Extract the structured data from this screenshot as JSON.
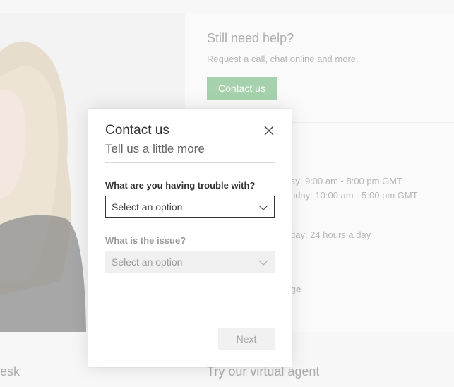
{
  "support_card": {
    "title": "Still need help?",
    "description": "Request a call, chat online and more.",
    "contact_button": "Contact us"
  },
  "hours": [
    "ay: 9:00 am - 8:00 pm GMT",
    "nday: 10:00 am - 5:00 pm GMT",
    "day: 24 hours a day"
  ],
  "partial_link": "ge",
  "bottom": {
    "left_partial": "esk",
    "virtual_agent": "Try our virtual agent"
  },
  "modal": {
    "title": "Contact us",
    "subtitle": "Tell us a little more",
    "question1": {
      "label": "What are you having trouble with?",
      "value": "Select an option"
    },
    "question2": {
      "label": "What is the issue?",
      "value": "Select an option"
    },
    "next_button": "Next"
  }
}
